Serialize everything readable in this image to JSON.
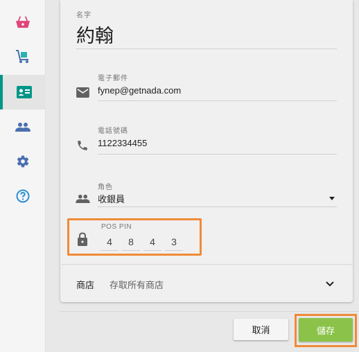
{
  "sidebar": {
    "items": [
      {
        "icon": "basket-icon"
      },
      {
        "icon": "cart-icon"
      },
      {
        "icon": "contact-card-icon",
        "active": true
      },
      {
        "icon": "people-icon"
      },
      {
        "icon": "gear-icon"
      },
      {
        "icon": "help-icon"
      }
    ]
  },
  "form": {
    "name": {
      "label": "名字",
      "value": "約翰"
    },
    "email": {
      "label": "電子郵件",
      "value": "fynep@getnada.com"
    },
    "phone": {
      "label": "電話號碼",
      "value": "1122334455"
    },
    "role": {
      "label": "角色",
      "value": "收銀員"
    },
    "pos_pin": {
      "label": "POS PIN",
      "digits": [
        "4",
        "8",
        "4",
        "3"
      ]
    },
    "store": {
      "label": "商店",
      "value": "存取所有商店"
    }
  },
  "footer": {
    "cancel_label": "取消",
    "save_label": "儲存"
  },
  "colors": {
    "accent": "#009688",
    "save": "#8bc34a",
    "highlight": "#f08a37",
    "basket": "#e0457b",
    "sidebar_icon": "#4a6fb0"
  }
}
